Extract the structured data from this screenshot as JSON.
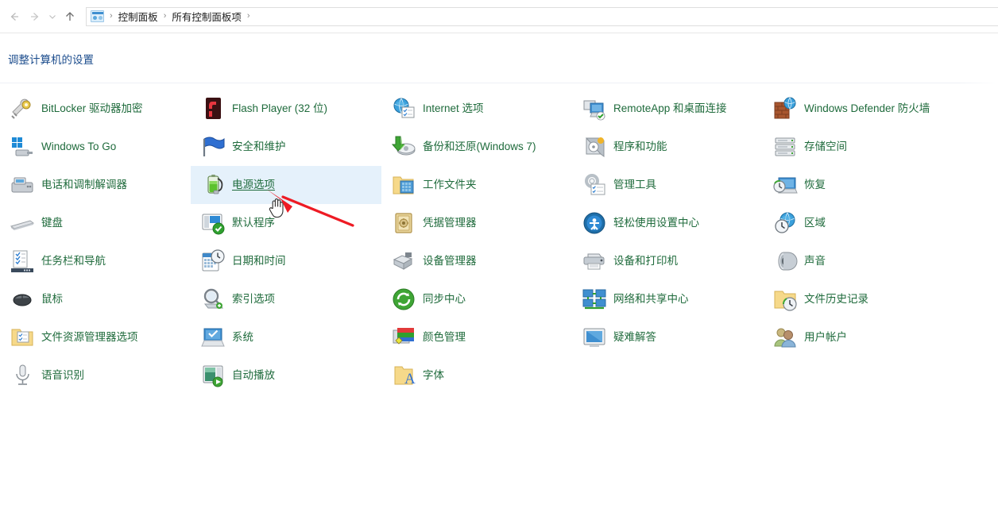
{
  "window": {
    "nav": {
      "back_icon": "arrow-left-icon",
      "forward_icon": "arrow-right-icon",
      "recent_icon": "chevron-down-icon",
      "up_icon": "arrow-up-icon"
    },
    "breadcrumb": {
      "icon": "control-panel-icon",
      "separator": "›",
      "items": [
        "控制面板",
        "所有控制面板项"
      ]
    }
  },
  "header": {
    "title": "调整计算机的设置"
  },
  "colors": {
    "link_green": "#1f6b3c",
    "header_blue": "#1a4b8c",
    "selection_blue": "#e5f1fb",
    "arrow_red": "#ee1b24"
  },
  "annotation": {
    "cursor": "hand-pointer-cursor",
    "arrow": "red-arrow-pointer",
    "points_at": "电源选项"
  },
  "columns": [
    {
      "items": [
        {
          "label": "BitLocker 驱动器加密",
          "icon": "bitlocker-icon",
          "selected": false
        },
        {
          "label": "Windows To Go",
          "icon": "windows-to-go-icon",
          "selected": false
        },
        {
          "label": "电话和调制解调器",
          "icon": "phone-modem-icon",
          "selected": false
        },
        {
          "label": "键盘",
          "icon": "keyboard-icon",
          "selected": false
        },
        {
          "label": "任务栏和导航",
          "icon": "taskbar-navigation-icon",
          "selected": false
        },
        {
          "label": "鼠标",
          "icon": "mouse-icon",
          "selected": false
        },
        {
          "label": "文件资源管理器选项",
          "icon": "file-explorer-options-icon",
          "selected": false
        },
        {
          "label": "语音识别",
          "icon": "speech-recognition-icon",
          "selected": false
        }
      ]
    },
    {
      "items": [
        {
          "label": "Flash Player (32 位)",
          "icon": "flash-player-icon",
          "selected": false
        },
        {
          "label": "安全和维护",
          "icon": "security-maintenance-icon",
          "selected": false
        },
        {
          "label": "电源选项",
          "icon": "power-options-icon",
          "selected": true
        },
        {
          "label": "默认程序",
          "icon": "default-programs-icon",
          "selected": false
        },
        {
          "label": "日期和时间",
          "icon": "date-time-icon",
          "selected": false
        },
        {
          "label": "索引选项",
          "icon": "indexing-options-icon",
          "selected": false
        },
        {
          "label": "系统",
          "icon": "system-icon",
          "selected": false
        },
        {
          "label": "自动播放",
          "icon": "autoplay-icon",
          "selected": false
        }
      ]
    },
    {
      "items": [
        {
          "label": "Internet 选项",
          "icon": "internet-options-icon",
          "selected": false
        },
        {
          "label": "备份和还原(Windows 7)",
          "icon": "backup-restore-icon",
          "selected": false
        },
        {
          "label": "工作文件夹",
          "icon": "work-folders-icon",
          "selected": false
        },
        {
          "label": "凭据管理器",
          "icon": "credential-manager-icon",
          "selected": false
        },
        {
          "label": "设备管理器",
          "icon": "device-manager-icon",
          "selected": false
        },
        {
          "label": "同步中心",
          "icon": "sync-center-icon",
          "selected": false
        },
        {
          "label": "颜色管理",
          "icon": "color-management-icon",
          "selected": false
        },
        {
          "label": "字体",
          "icon": "fonts-icon",
          "selected": false
        }
      ]
    },
    {
      "items": [
        {
          "label": "RemoteApp 和桌面连接",
          "icon": "remoteapp-desktop-connections-icon",
          "selected": false
        },
        {
          "label": "程序和功能",
          "icon": "programs-features-icon",
          "selected": false
        },
        {
          "label": "管理工具",
          "icon": "administrative-tools-icon",
          "selected": false
        },
        {
          "label": "轻松使用设置中心",
          "icon": "ease-of-access-center-icon",
          "selected": false
        },
        {
          "label": "设备和打印机",
          "icon": "devices-printers-icon",
          "selected": false
        },
        {
          "label": "网络和共享中心",
          "icon": "network-sharing-center-icon",
          "selected": false
        },
        {
          "label": "疑难解答",
          "icon": "troubleshooting-icon",
          "selected": false
        }
      ]
    },
    {
      "items": [
        {
          "label": "Windows Defender 防火墙",
          "icon": "windows-defender-firewall-icon",
          "selected": false,
          "wrap": true
        },
        {
          "label": "存储空间",
          "icon": "storage-spaces-icon",
          "selected": false
        },
        {
          "label": "恢复",
          "icon": "recovery-icon",
          "selected": false
        },
        {
          "label": "区域",
          "icon": "region-icon",
          "selected": false
        },
        {
          "label": "声音",
          "icon": "sound-icon",
          "selected": false
        },
        {
          "label": "文件历史记录",
          "icon": "file-history-icon",
          "selected": false
        },
        {
          "label": "用户帐户",
          "icon": "user-accounts-icon",
          "selected": false
        }
      ]
    }
  ]
}
